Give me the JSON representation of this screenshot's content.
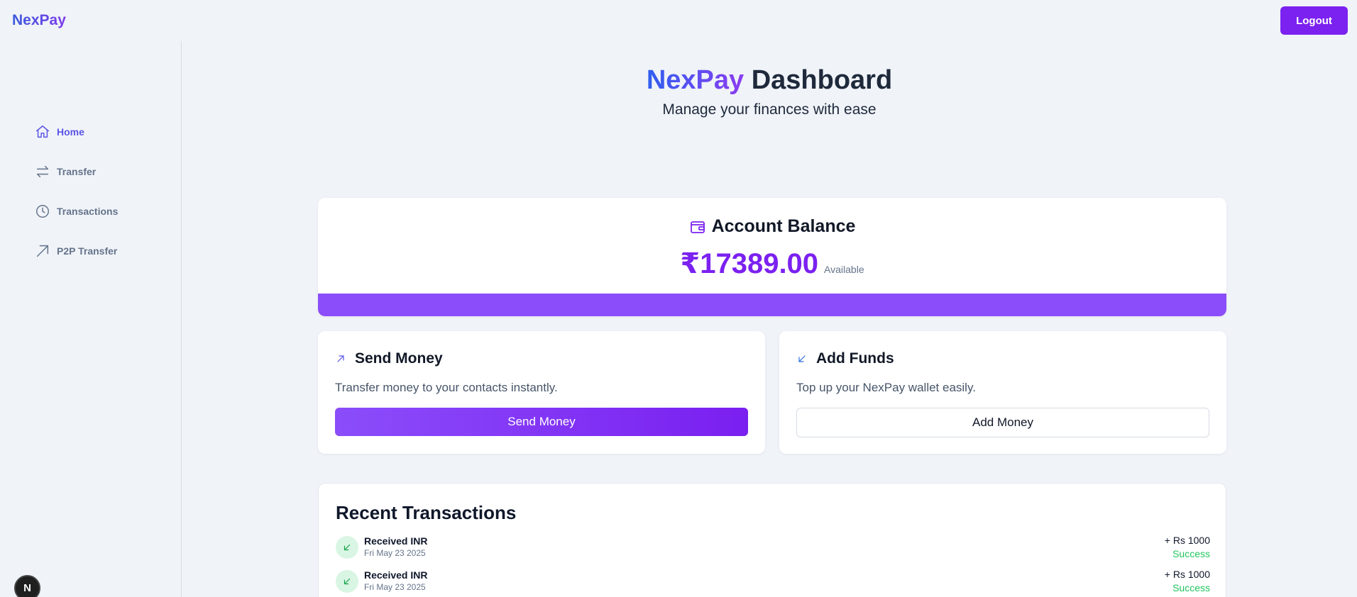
{
  "app": {
    "name": "NexPay"
  },
  "header": {
    "logout_label": "Logout"
  },
  "sidebar": {
    "items": [
      {
        "label": "Home",
        "icon": "home-icon",
        "active": true
      },
      {
        "label": "Transfer",
        "icon": "arrows-swap-icon",
        "active": false
      },
      {
        "label": "Transactions",
        "icon": "clock-icon",
        "active": false
      },
      {
        "label": "P2P Transfer",
        "icon": "arrow-up-right-icon",
        "active": false
      }
    ],
    "badge": "N"
  },
  "hero": {
    "brand": "NexPay",
    "title_rest": "Dashboard",
    "subtitle": "Manage your finances with ease"
  },
  "balance": {
    "title": "Account Balance",
    "icon": "wallet-icon",
    "amount": "₹17389.00",
    "available_label": "Available"
  },
  "send_card": {
    "title": "Send Money",
    "icon": "arrow-up-right-icon",
    "description": "Transfer money to your contacts instantly.",
    "button_label": "Send Money"
  },
  "funds_card": {
    "title": "Add Funds",
    "icon": "arrow-down-left-icon",
    "description": "Top up your NexPay wallet easily.",
    "button_label": "Add Money"
  },
  "transactions": {
    "title": "Recent Transactions",
    "rows": [
      {
        "label": "Received INR",
        "date": "Fri May 23 2025",
        "amount": "+ Rs 1000",
        "status": "Success"
      },
      {
        "label": "Received INR",
        "date": "Fri May 23 2025",
        "amount": "+ Rs 1000",
        "status": "Success"
      }
    ]
  },
  "colors": {
    "accent": "#7b21f0",
    "brand_blue": "#2f5ff0",
    "success": "#22c55e",
    "background": "#f0f3f8"
  }
}
